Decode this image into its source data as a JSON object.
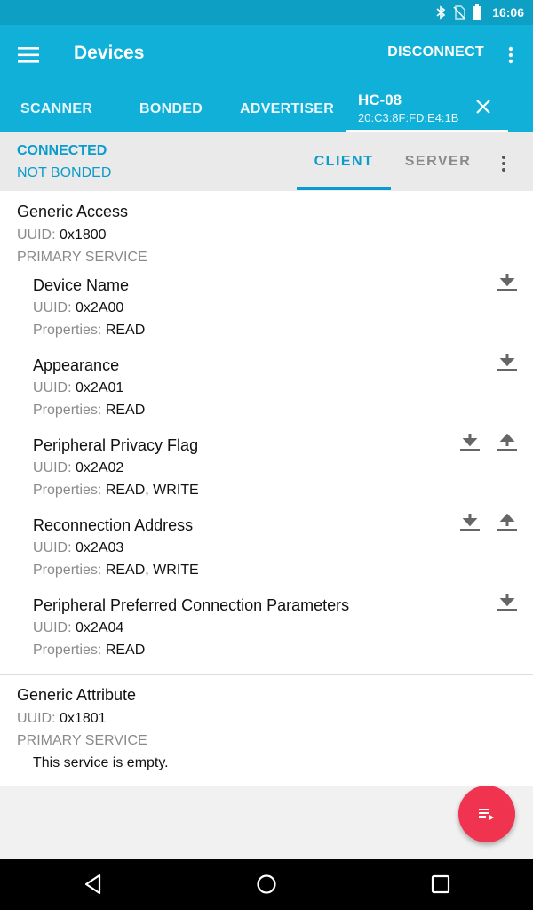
{
  "status_bar": {
    "time": "16:06"
  },
  "app_bar": {
    "title": "Devices",
    "disconnect_label": "DISCONNECT"
  },
  "tabs": [
    {
      "label": "SCANNER"
    },
    {
      "label": "BONDED"
    },
    {
      "label": "ADVERTISER"
    }
  ],
  "active_tab": {
    "name": "HC-08",
    "address": "20:C3:8F:FD:E4:1B"
  },
  "connection": {
    "state": "CONNECTED",
    "bond": "NOT BONDED"
  },
  "subtabs": {
    "client": "CLIENT",
    "server": "SERVER",
    "selected": "CLIENT"
  },
  "labels": {
    "uuid": "UUID:",
    "properties": "Properties:"
  },
  "services": [
    {
      "name": "Generic Access",
      "uuid": "0x1800",
      "type": "PRIMARY SERVICE",
      "characteristics": [
        {
          "name": "Device Name",
          "uuid": "0x2A00",
          "properties": "READ"
        },
        {
          "name": "Appearance",
          "uuid": "0x2A01",
          "properties": "READ"
        },
        {
          "name": "Peripheral Privacy Flag",
          "uuid": "0x2A02",
          "properties": "READ, WRITE"
        },
        {
          "name": "Reconnection Address",
          "uuid": "0x2A03",
          "properties": "READ, WRITE"
        },
        {
          "name": "Peripheral Preferred Connection Parameters",
          "uuid": "0x2A04",
          "properties": "READ"
        }
      ]
    },
    {
      "name": "Generic Attribute",
      "uuid": "0x1801",
      "type": "PRIMARY SERVICE",
      "empty_text": "This service is empty."
    }
  ],
  "colors": {
    "primary": "#10b0d9",
    "primary_dark": "#0d9fc4",
    "accent_text": "#0a9ccc",
    "fab": "#f0334f"
  },
  "icons": {
    "menu": "hamburger-icon",
    "overflow": "more-vert-icon",
    "close": "close-icon",
    "read": "download-icon",
    "write": "upload-icon",
    "fab": "queue-icon",
    "status": [
      "bluetooth-icon",
      "no-sim-icon",
      "battery-icon"
    ],
    "nav": [
      "back-icon",
      "home-icon",
      "recents-icon"
    ]
  }
}
